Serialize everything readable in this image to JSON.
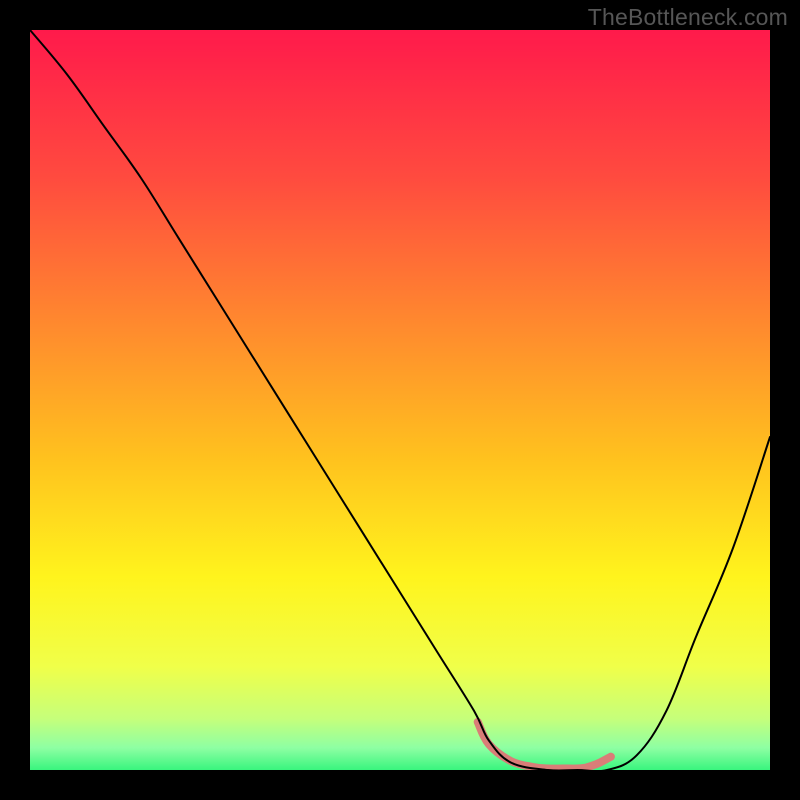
{
  "watermark": "TheBottleneck.com",
  "chart_data": {
    "type": "line",
    "title": "",
    "xlabel": "",
    "ylabel": "",
    "xlim": [
      0,
      100
    ],
    "ylim": [
      0,
      100
    ],
    "background": {
      "type": "vertical-gradient",
      "stops": [
        {
          "offset": 0.0,
          "color": "#ff1a4b"
        },
        {
          "offset": 0.2,
          "color": "#ff4b3f"
        },
        {
          "offset": 0.4,
          "color": "#ff8a2e"
        },
        {
          "offset": 0.58,
          "color": "#ffc21e"
        },
        {
          "offset": 0.74,
          "color": "#fff41d"
        },
        {
          "offset": 0.86,
          "color": "#f0ff49"
        },
        {
          "offset": 0.93,
          "color": "#c6ff7a"
        },
        {
          "offset": 0.97,
          "color": "#8effa3"
        },
        {
          "offset": 1.0,
          "color": "#39f57e"
        }
      ]
    },
    "series": [
      {
        "name": "primary-curve",
        "color": "#000000",
        "width": 2,
        "x": [
          0,
          5,
          10,
          15,
          20,
          25,
          30,
          35,
          40,
          45,
          50,
          55,
          60,
          62,
          65,
          70,
          74,
          78,
          82,
          86,
          90,
          95,
          100
        ],
        "values": [
          100,
          94,
          87,
          80,
          72,
          64,
          56,
          48,
          40,
          32,
          24,
          16,
          8,
          4,
          1,
          0,
          0,
          0,
          2,
          8,
          18,
          30,
          45
        ]
      },
      {
        "name": "highlight-segment",
        "color": "#d97d78",
        "width": 8,
        "x": [
          60.5,
          62,
          65,
          68,
          70,
          72,
          74,
          75,
          76,
          77,
          78.5
        ],
        "values": [
          6.5,
          3.5,
          1.2,
          0.4,
          0.2,
          0.2,
          0.2,
          0.3,
          0.6,
          1.0,
          1.8
        ]
      }
    ]
  }
}
